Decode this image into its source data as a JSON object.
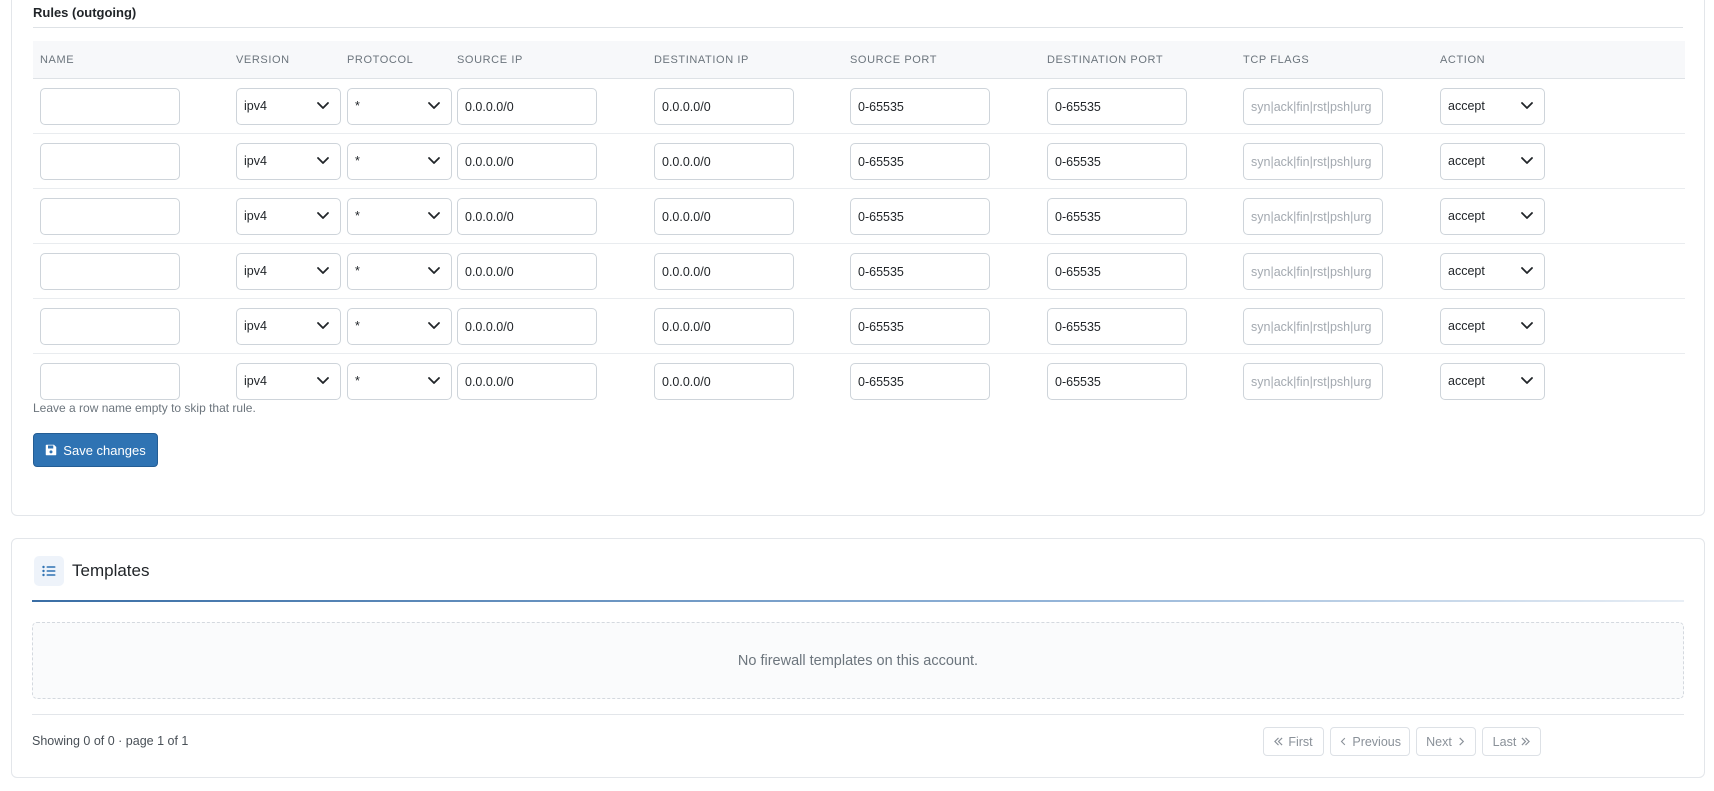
{
  "rules": {
    "title": "Rules (outgoing)",
    "columns": [
      "NAME",
      "VERSION",
      "PROTOCOL",
      "SOURCE IP",
      "DESTINATION IP",
      "SOURCE PORT",
      "DESTINATION PORT",
      "TCP FLAGS",
      "ACTION"
    ],
    "tcp_flags_placeholder": "syn|ack|fin|rst|psh|urg",
    "rows": [
      {
        "name": "",
        "version": "ipv4",
        "protocol": "*",
        "source_ip": "0.0.0.0/0",
        "destination_ip": "0.0.0.0/0",
        "source_port": "0-65535",
        "destination_port": "0-65535",
        "tcp_flags": "",
        "action": "accept"
      },
      {
        "name": "",
        "version": "ipv4",
        "protocol": "*",
        "source_ip": "0.0.0.0/0",
        "destination_ip": "0.0.0.0/0",
        "source_port": "0-65535",
        "destination_port": "0-65535",
        "tcp_flags": "",
        "action": "accept"
      },
      {
        "name": "",
        "version": "ipv4",
        "protocol": "*",
        "source_ip": "0.0.0.0/0",
        "destination_ip": "0.0.0.0/0",
        "source_port": "0-65535",
        "destination_port": "0-65535",
        "tcp_flags": "",
        "action": "accept"
      },
      {
        "name": "",
        "version": "ipv4",
        "protocol": "*",
        "source_ip": "0.0.0.0/0",
        "destination_ip": "0.0.0.0/0",
        "source_port": "0-65535",
        "destination_port": "0-65535",
        "tcp_flags": "",
        "action": "accept"
      },
      {
        "name": "",
        "version": "ipv4",
        "protocol": "*",
        "source_ip": "0.0.0.0/0",
        "destination_ip": "0.0.0.0/0",
        "source_port": "0-65535",
        "destination_port": "0-65535",
        "tcp_flags": "",
        "action": "accept"
      },
      {
        "name": "",
        "version": "ipv4",
        "protocol": "*",
        "source_ip": "0.0.0.0/0",
        "destination_ip": "0.0.0.0/0",
        "source_port": "0-65535",
        "destination_port": "0-65535",
        "tcp_flags": "",
        "action": "accept"
      }
    ],
    "hint": "Leave a row name empty to skip that rule.",
    "save_label": "Save changes",
    "save_icon": "floppy-disk-icon",
    "chevron_icon": "chevron-down-icon"
  },
  "templates": {
    "title": "Templates",
    "icon": "list-icon",
    "empty_message": "No firewall templates on this account.",
    "status": "Showing 0 of 0 · page 1 of 1",
    "pagination": {
      "first": "First",
      "previous": "Previous",
      "next": "Next",
      "last": "Last"
    }
  },
  "colors": {
    "primary": "#2f73b3",
    "border": "#ced4da",
    "muted_text": "#6c757d"
  }
}
